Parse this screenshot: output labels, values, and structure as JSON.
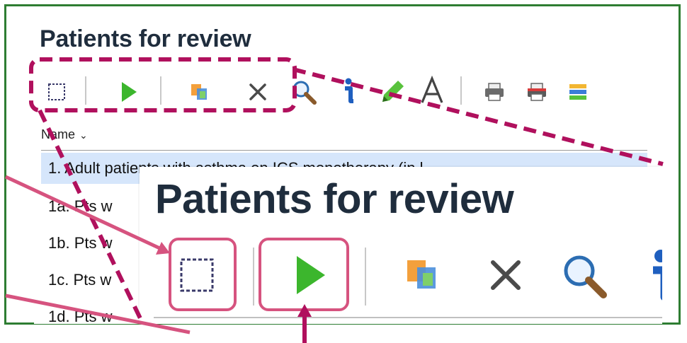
{
  "panel_small": {
    "title": "Patients for review",
    "column_header": "Name",
    "column_chevron": "⌄",
    "rows": [
      "1. Adult patients with asthma on ICS monotherapy (in l",
      "1a. Pts w",
      "1b. Pts w",
      "1c. Pts w",
      "1d. Pts w"
    ],
    "toolbar_icons": [
      "select-all-icon",
      "run-icon",
      "copy-icon",
      "delete-icon",
      "search-icon",
      "info-icon",
      "highlight-icon",
      "font-icon",
      "print-icon",
      "print-red-icon",
      "report-icon"
    ]
  },
  "panel_zoom": {
    "title": "Patients for review",
    "toolbar_icons": [
      "select-all-icon",
      "run-icon",
      "copy-icon",
      "delete-icon",
      "search-icon",
      "info-icon"
    ]
  },
  "colors": {
    "frame": "#2e7d32",
    "callout": "#b0105d",
    "arrow": "#d6537f",
    "selection": "#d6e6fb",
    "run_green": "#3cb62d"
  }
}
